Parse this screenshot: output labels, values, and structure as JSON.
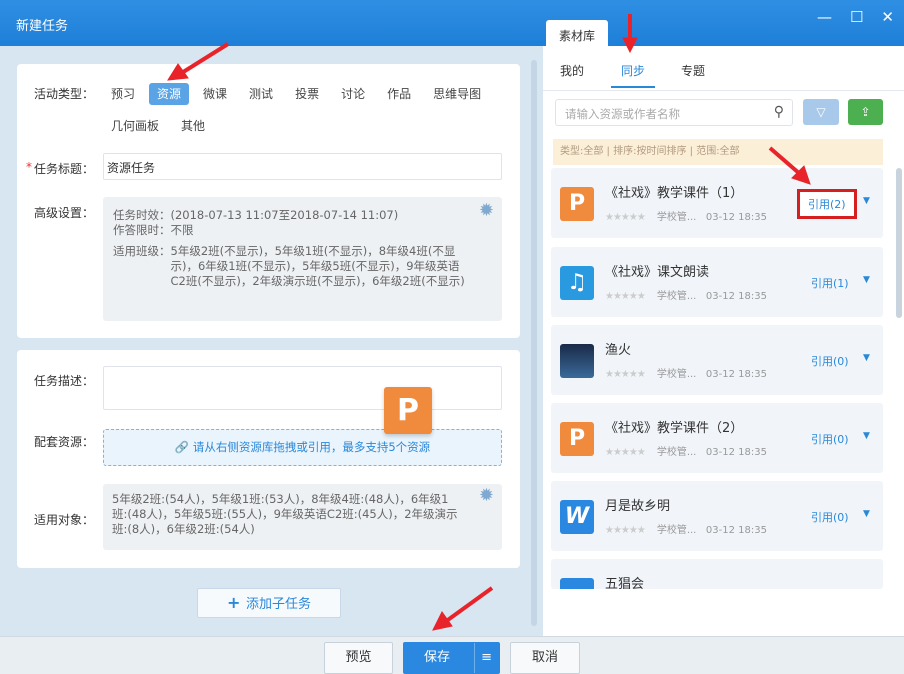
{
  "window": {
    "title": "新建任务",
    "min": "—",
    "max": "☐",
    "close": "✕"
  },
  "form": {
    "activity_type_label": "活动类型：",
    "types": [
      "预习",
      "资源",
      "微课",
      "测试",
      "投票",
      "讨论",
      "作品",
      "思维导图",
      "几何画板",
      "其他"
    ],
    "selected_type": "资源",
    "title_label": "任务标题：",
    "required_mark": "*",
    "title_value": "资源任务",
    "advanced_label": "高级设置：",
    "time_line": "任务时效：(2018-07-13 11:07至2018-07-14 11:07)",
    "limit_line": "作答限时：不限",
    "class_label": "适用班级：",
    "class_value": "5年级2班(不显示)，5年级1班(不显示)，8年级4班(不显示)，6年级1班(不显示)，5年级5班(不显示)，9年级英语C2班(不显示)，2年级演示班(不显示)，6年级2班(不显示)",
    "desc_label": "任务描述：",
    "desc_value": "",
    "resource_label": "配套资源：",
    "resource_hint": "请从右侧资源库拖拽或引用，最多支持5个资源",
    "target_label": "适用对象：",
    "target_value": "5年级2班:(54人)，5年级1班:(53人)，8年级4班:(48人)，6年级1班:(48人)，5年级5班:(55人)，9年级英语C2班:(45人)，2年级演示班:(8人)，6年级2班:(54人)",
    "add_subtask": "添加子任务"
  },
  "library": {
    "tab": "素材库",
    "subtabs": [
      "我的",
      "同步",
      "专题"
    ],
    "active_subtab": "同步",
    "search_placeholder": "请输入资源或作者名称",
    "filter_summary": "类型:全部 | 排序:按时间排序 | 范围:全部",
    "items": [
      {
        "name": "《社戏》教学课件（1）",
        "icon": "ppt-icon",
        "stars": "★★★★★",
        "source": "学校管...",
        "date": "03-12 18:35",
        "quote": "引用(2)"
      },
      {
        "name": "《社戏》课文朗读",
        "icon": "audio-icon",
        "stars": "★★★★★",
        "source": "学校管...",
        "date": "03-12 18:35",
        "quote": "引用(1)"
      },
      {
        "name": "渔火",
        "icon": "image-icon",
        "stars": "★★★★★",
        "source": "学校管...",
        "date": "03-12 18:35",
        "quote": "引用(0)"
      },
      {
        "name": "《社戏》教学课件（2）",
        "icon": "ppt-icon",
        "stars": "★★★★★",
        "source": "学校管...",
        "date": "03-12 18:35",
        "quote": "引用(0)"
      },
      {
        "name": "月是故乡明",
        "icon": "word-icon",
        "stars": "★★★★★",
        "source": "学校管...",
        "date": "03-12 18:35",
        "quote": "引用(0)"
      },
      {
        "name": "五猖会"
      }
    ]
  },
  "footer": {
    "preview": "预览",
    "save": "保存",
    "save_menu": "≡",
    "cancel": "取消"
  },
  "colors": {
    "primary": "#1e7fd8",
    "ppt": "#f08a3c",
    "word": "#2a88e0",
    "green": "#4caf50"
  }
}
